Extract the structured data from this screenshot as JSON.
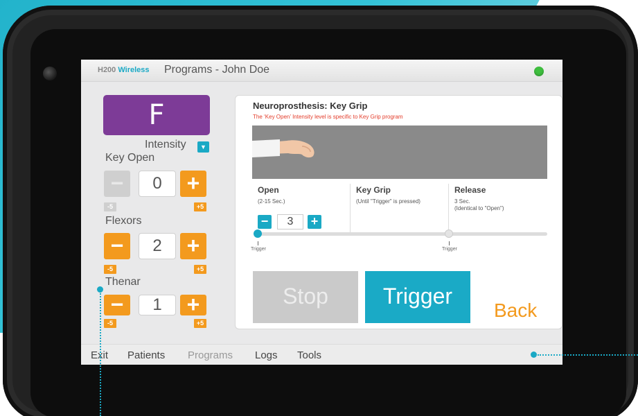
{
  "header": {
    "brand_prefix": "H200",
    "brand_word": "Wireless",
    "title": "Programs - John Doe"
  },
  "program": {
    "letter": "F",
    "intensity_label": "Intensity",
    "dropdown_icon": "caret-down"
  },
  "groups": [
    {
      "label": "Key Open",
      "value": "0",
      "minus": "−",
      "plus": "+",
      "min_tag": "-5",
      "max_tag": "+5"
    },
    {
      "label": "Flexors",
      "value": "2",
      "minus": "−",
      "plus": "+",
      "min_tag": "-5",
      "max_tag": "+5"
    },
    {
      "label": "Thenar",
      "value": "1",
      "minus": "−",
      "plus": "+",
      "min_tag": "-5",
      "max_tag": "+5"
    }
  ],
  "panel": {
    "title": "Neuroprosthesis:  Key Grip",
    "note": "The ‘Key Open’ Intensity level is specific to Key Grip program",
    "phases": [
      {
        "name": "Open",
        "desc": "(2-15 Sec.)"
      },
      {
        "name": "Key Grip",
        "desc": "(Until \"Trigger\" is pressed)"
      },
      {
        "name": "Release",
        "desc": "3 Sec.",
        "desc2": "(Identical to \"Open\")"
      }
    ],
    "open_value": "3",
    "open_minus": "−",
    "open_plus": "+",
    "trigger_label_1": "Trigger",
    "trigger_label_2": "Trigger"
  },
  "actions": {
    "stop": "Stop",
    "trigger": "Trigger",
    "back": "Back"
  },
  "menu": {
    "exit": "Exit",
    "patients": "Patients",
    "programs": "Programs",
    "logs": "Logs",
    "tools": "Tools"
  },
  "colors": {
    "accent": "#1aa9c5",
    "orange": "#f39a1e",
    "purple": "#7d3b97",
    "status": "#3fbf3f"
  }
}
